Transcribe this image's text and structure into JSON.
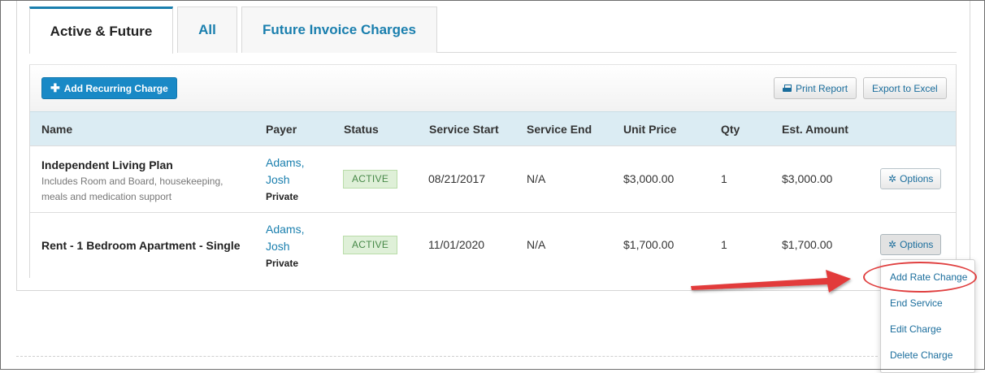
{
  "tabs": [
    {
      "label": "Active & Future",
      "active": true
    },
    {
      "label": "All",
      "active": false
    },
    {
      "label": "Future Invoice Charges",
      "active": false
    }
  ],
  "toolbar": {
    "add_label": "Add Recurring Charge",
    "print_label": "Print Report",
    "export_label": "Export to Excel"
  },
  "table": {
    "headers": [
      "Name",
      "Payer",
      "Status",
      "Service Start",
      "Service End",
      "Unit Price",
      "Qty",
      "Est. Amount"
    ],
    "rows": [
      {
        "name": "Independent Living Plan",
        "description": "Includes Room and Board, housekeeping, meals and medication support",
        "payer_last": "Adams,",
        "payer_first": "Josh",
        "payer_type": "Private",
        "status": "ACTIVE",
        "service_start": "08/21/2017",
        "service_end": "N/A",
        "unit_price": "$3,000.00",
        "qty": "1",
        "est_amount": "$3,000.00",
        "options_label": "Options"
      },
      {
        "name": "Rent - 1 Bedroom Apartment - Single",
        "description": "",
        "payer_last": "Adams,",
        "payer_first": "Josh",
        "payer_type": "Private",
        "status": "ACTIVE",
        "service_start": "11/01/2020",
        "service_end": "N/A",
        "unit_price": "$1,700.00",
        "qty": "1",
        "est_amount": "$1,700.00",
        "options_label": "Options"
      }
    ]
  },
  "options_menu": {
    "items": [
      "Add Rate Change",
      "End Service",
      "Edit Charge",
      "Delete Charge"
    ]
  },
  "colors": {
    "accent": "#1a7fae",
    "primary_button": "#1989c6",
    "table_header": "#dbecf3",
    "status_green_bg": "#dff0d8",
    "status_green_text": "#468847",
    "annotation_red": "#e04040"
  },
  "icons": {
    "add": "plus-icon",
    "print": "printer-icon",
    "options": "gear-icon"
  }
}
